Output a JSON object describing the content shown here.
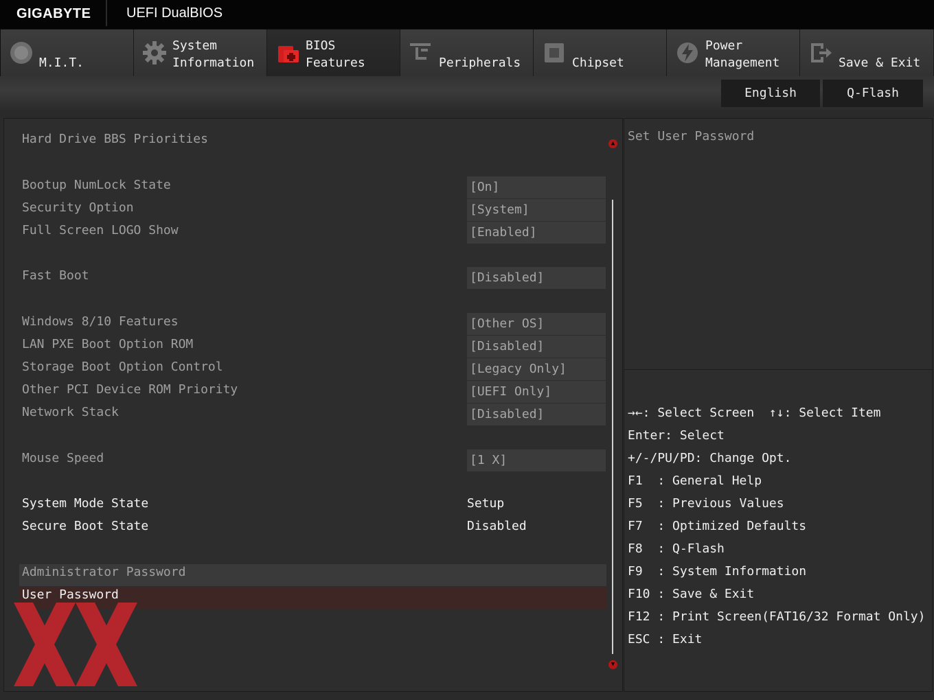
{
  "brand": "GIGABYTE",
  "product": "UEFI DualBIOS",
  "tabs": [
    {
      "line1": "",
      "line2": "M.I.T.",
      "icon": "mit-dial-icon"
    },
    {
      "line1": "System",
      "line2": "Information",
      "icon": "gear-icon"
    },
    {
      "line1": "BIOS",
      "line2": "Features",
      "icon": "bios-chip-icon"
    },
    {
      "line1": "",
      "line2": "Peripherals",
      "icon": "peripherals-icon"
    },
    {
      "line1": "",
      "line2": "Chipset",
      "icon": "chipset-icon"
    },
    {
      "line1": "Power",
      "line2": "Management",
      "icon": "power-icon"
    },
    {
      "line1": "",
      "line2": "Save & Exit",
      "icon": "exit-door-icon"
    }
  ],
  "active_tab": "BIOS Features",
  "buttons": {
    "language": "English",
    "qflash": "Q-Flash"
  },
  "settings": {
    "hdd_bbs": "Hard Drive BBS Priorities",
    "numlock": {
      "label": "Bootup NumLock State",
      "value": "[On]"
    },
    "security": {
      "label": "Security Option",
      "value": "[System]"
    },
    "logo": {
      "label": "Full Screen LOGO Show",
      "value": "[Enabled]"
    },
    "fastboot": {
      "label": "Fast Boot",
      "value": "[Disabled]"
    },
    "win810": {
      "label": "Windows 8/10 Features",
      "value": "[Other OS]"
    },
    "lanpxe": {
      "label": "LAN PXE Boot Option ROM",
      "value": "[Disabled]"
    },
    "storage": {
      "label": "Storage Boot Option Control",
      "value": "[Legacy Only]"
    },
    "otherpci": {
      "label": "Other PCI Device ROM Priority",
      "value": "[UEFI Only]"
    },
    "network": {
      "label": "Network Stack",
      "value": "[Disabled]"
    },
    "mouse": {
      "label": "Mouse Speed",
      "value": "[1 X]"
    },
    "sysmode": {
      "label": "System Mode State",
      "value": "Setup"
    },
    "secureboot": {
      "label": "Secure Boot State",
      "value": "Disabled"
    },
    "adminpw": "Administrator Password",
    "userpw": "User Password"
  },
  "help": {
    "description": "Set User Password",
    "keys": [
      "→←: Select Screen  ↑↓: Select Item",
      "Enter: Select",
      "+/-/PU/PD: Change Opt.",
      "F1  : General Help",
      "F5  : Previous Values",
      "F7  : Optimized Defaults",
      "F8  : Q-Flash",
      "F9  : System Information",
      "F10 : Save & Exit",
      "F12 : Print Screen(FAT16/32 Format Only)",
      "ESC : Exit"
    ]
  },
  "colors": {
    "accent": "#b01818",
    "selected_row": "#3e2624",
    "logo_red": "#c0262b"
  }
}
